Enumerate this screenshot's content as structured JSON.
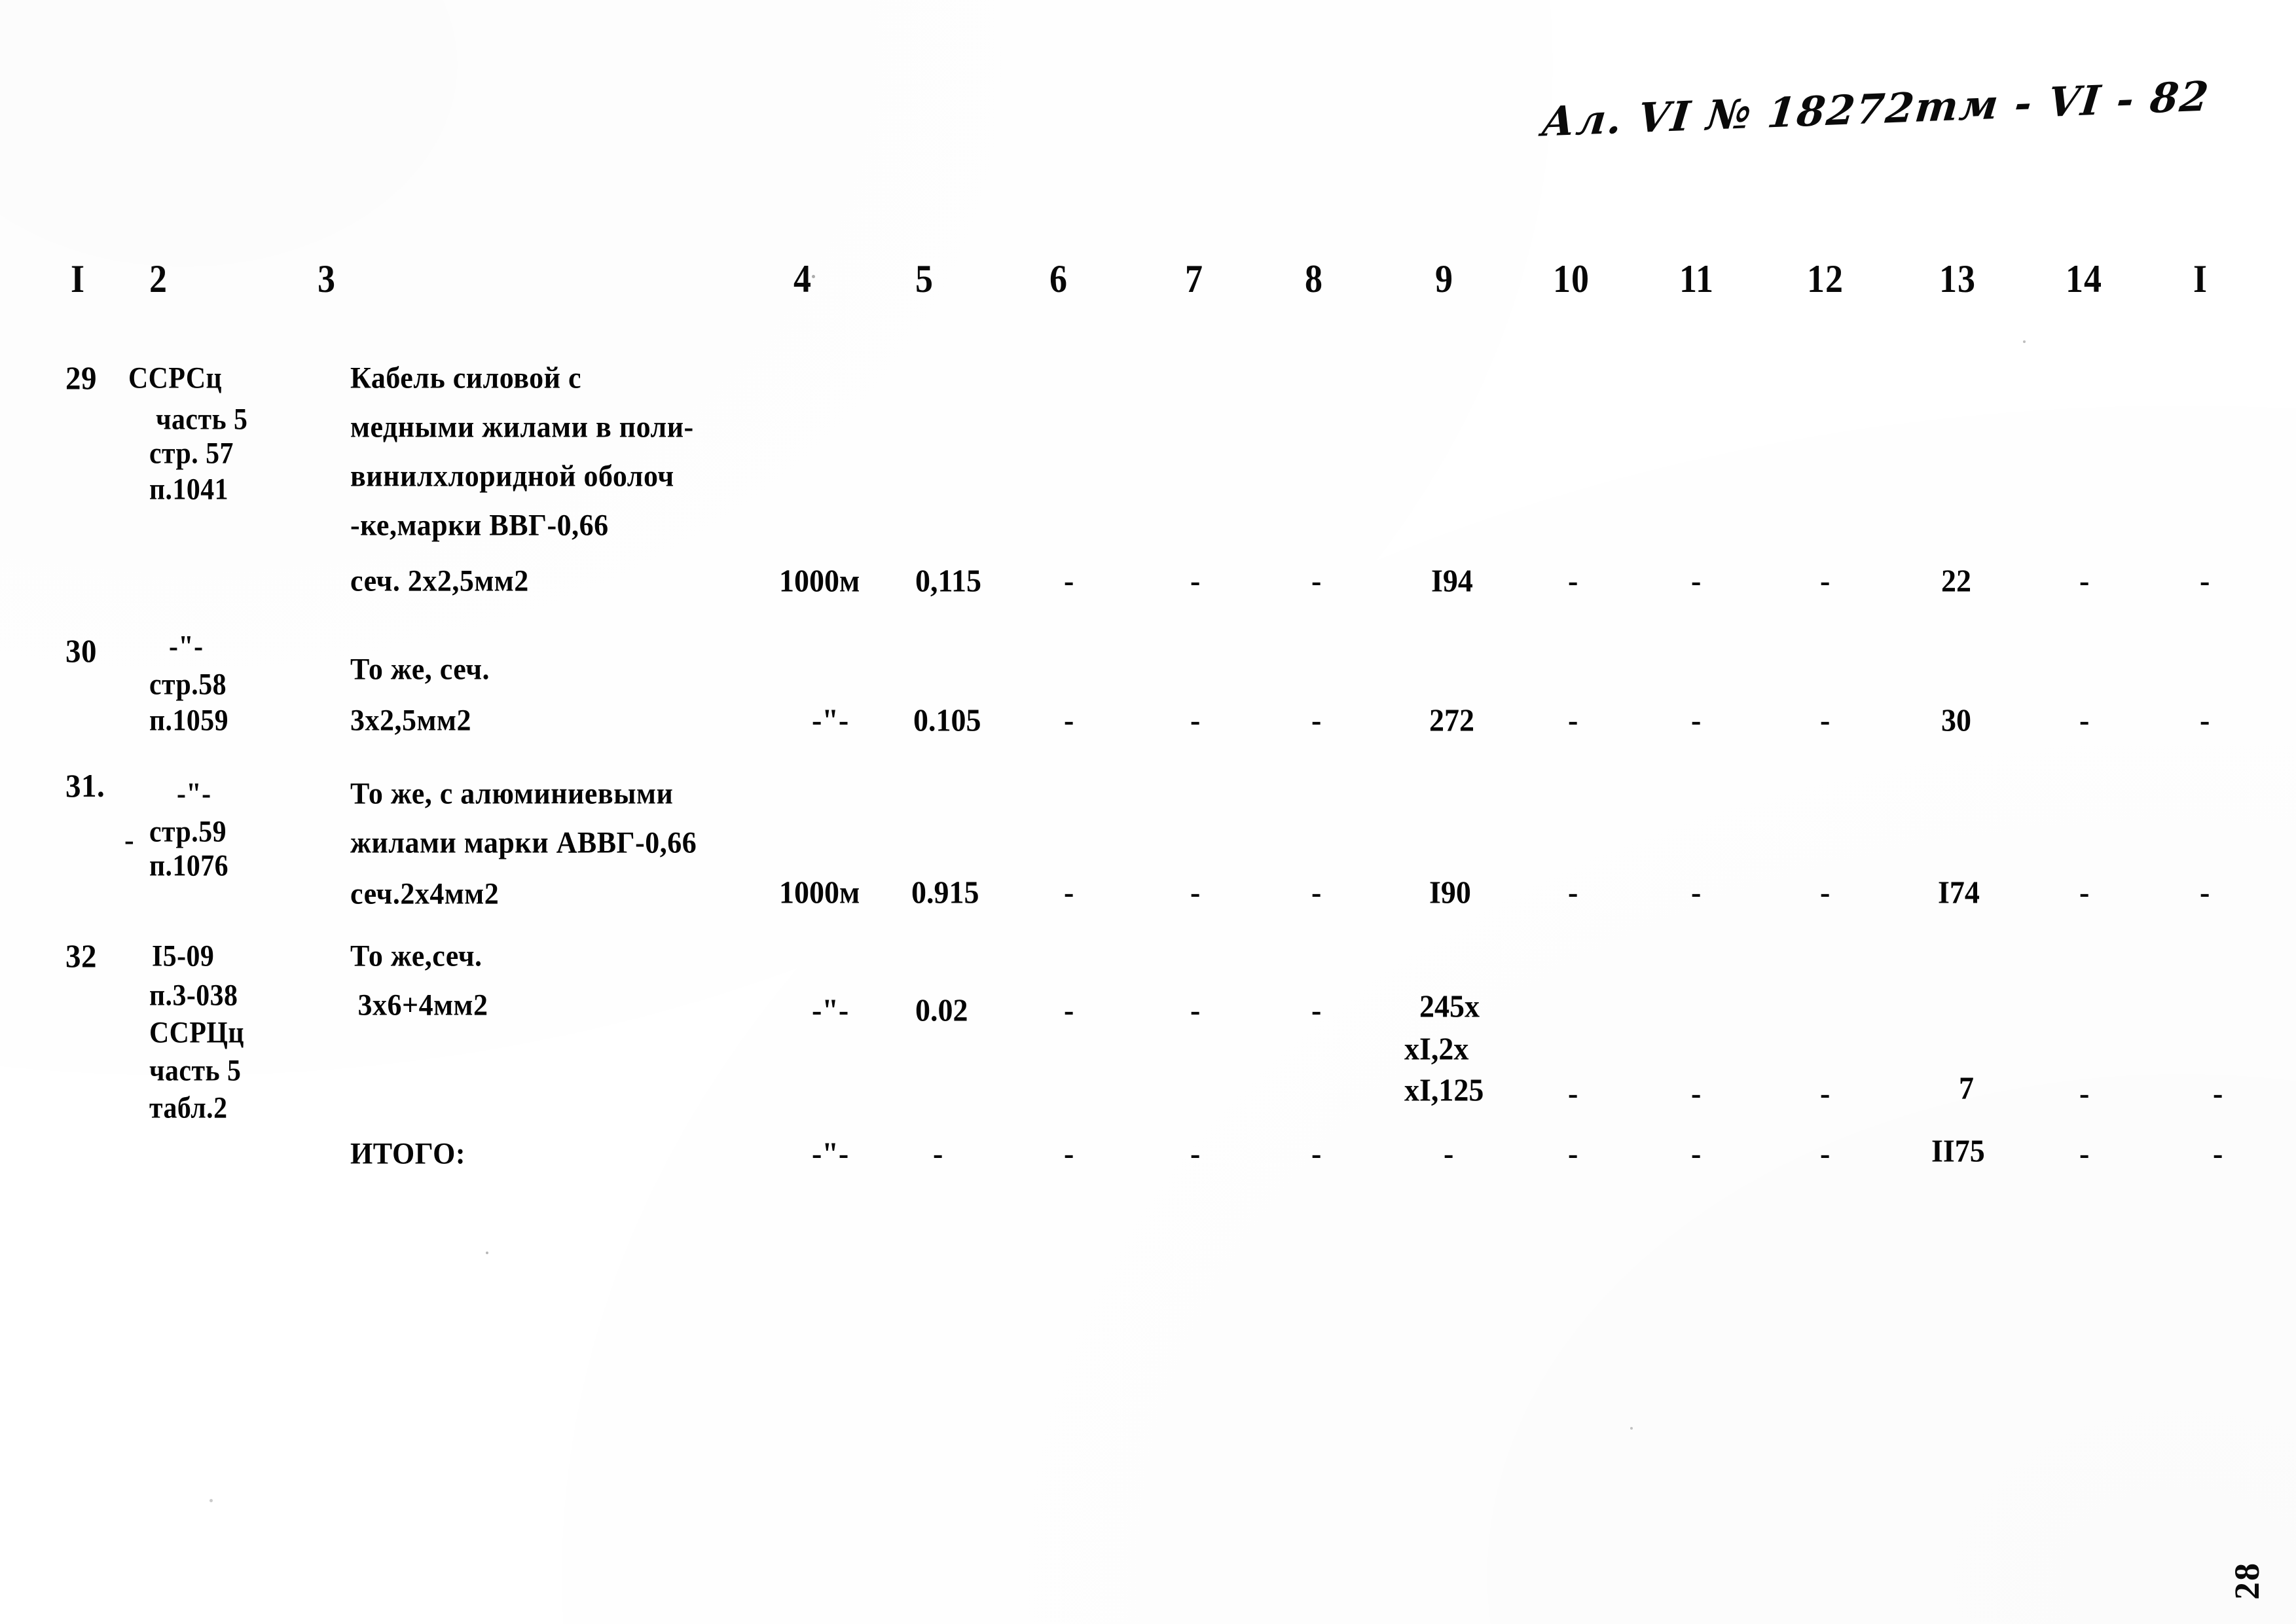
{
  "document": {
    "handwritten_header": "Ал. VI № 18272тм - VI - 82",
    "page_number": "28"
  },
  "column_headers": [
    "I",
    "2",
    "3",
    "4",
    "5",
    "6",
    "7",
    "8",
    "9",
    "10",
    "11",
    "12",
    "13",
    "14",
    "I"
  ],
  "rows": [
    {
      "no": "29",
      "ref_lines": [
        "ССРСц",
        "часть 5",
        "стр. 57",
        "п.1041"
      ],
      "desc_lines": [
        "Кабель силовой с",
        "медными жилами в поли-",
        "винилхлоридной оболоч",
        "-ке,марки ВВГ-0,66",
        "сеч. 2х2,5мм2"
      ],
      "unit": "1000м",
      "c5": "0,115",
      "c6": "-",
      "c7": "-",
      "c8": "-",
      "c9": "I94",
      "c10": "-",
      "c11": "-",
      "c12": "-",
      "c13": "22",
      "c14": "-",
      "c15": "-"
    },
    {
      "no": "30",
      "ref_lines": [
        "-\"-",
        "стр.58",
        "п.1059"
      ],
      "desc_lines": [
        "То же, сеч.",
        "3х2,5мм2"
      ],
      "unit": "-\"-",
      "c5": "0.105",
      "c6": "-",
      "c7": "-",
      "c8": "-",
      "c9": "272",
      "c10": "-",
      "c11": "-",
      "c12": "-",
      "c13": "30",
      "c14": "-",
      "c15": "-"
    },
    {
      "no": "31.",
      "ref_lines": [
        "-\"-",
        "стр.59",
        "п.1076"
      ],
      "desc_lines": [
        "То же, с алюминиевыми",
        "жилами марки АВВГ-0,66",
        "сеч.2х4мм2"
      ],
      "unit": "1000м",
      "c5": "0.915",
      "c6": "-",
      "c7": "-",
      "c8": "-",
      "c9": "I90",
      "c10": "-",
      "c11": "-",
      "c12": "-",
      "c13": "I74",
      "c14": "-",
      "c15": "-"
    },
    {
      "no": "32",
      "ref_lines": [
        "I5-09",
        "п.3-038",
        "ССРЦц",
        "часть 5",
        "табл.2"
      ],
      "desc_lines": [
        "То же,сеч.",
        " 3х6+4мм2"
      ],
      "unit": "-\"-",
      "c5": "0.02",
      "c6": "-",
      "c7": "-",
      "c8": "-",
      "c9_lines": [
        "245х",
        "хI,2х",
        "хI,125"
      ],
      "c10": "-",
      "c11": "-",
      "c12": "-",
      "c13": "7",
      "c14": "-",
      "c15": "-"
    }
  ],
  "total_row": {
    "label": "ИТОГО:",
    "unit": "-\"-",
    "c5": "-",
    "c6": "-",
    "c7": "-",
    "c8": "-",
    "c9": "-",
    "c10": "-",
    "c11": "-",
    "c12": "-",
    "c13": "II75",
    "c14": "-",
    "c15": "-"
  }
}
